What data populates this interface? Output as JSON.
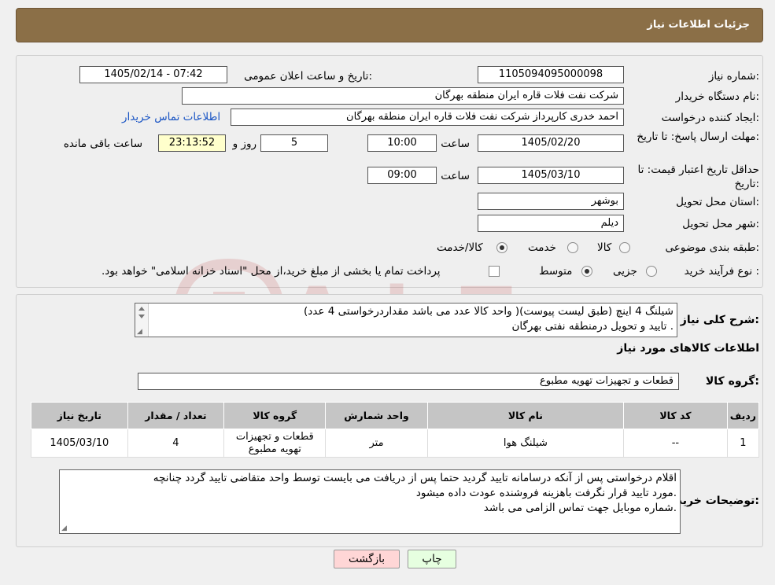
{
  "header": {
    "title": "جزئیات اطلاعات نیاز"
  },
  "form": {
    "need_number_label": "شماره نیاز:",
    "need_number": "1105094095000098",
    "announce_label": "تاریخ و ساعت اعلان عمومی:",
    "announce_value": "1405/02/14 - 07:42",
    "buyer_org_label": "نام دستگاه خریدار:",
    "buyer_org": "شرکت نفت فلات قاره ایران منطقه بهرگان",
    "creator_label": "ایجاد کننده درخواست:",
    "creator": "احمد خدری کارپرداز شرکت نفت فلات قاره ایران منطقه بهرگان",
    "contact_link": "اطلاعات تماس خریدار",
    "deadline_label": "مهلت ارسال پاسخ: تا تاریخ:",
    "deadline_date": "1405/02/20",
    "time_label": "ساعت",
    "deadline_time": "10:00",
    "days_value": "5",
    "days_label": "روز و",
    "remaining_time": "23:13:52",
    "remaining_label": "ساعت باقی مانده",
    "validity_label": "حداقل تاریخ اعتبار قیمت: تا تاریخ:",
    "validity_date": "1405/03/10",
    "validity_time": "09:00",
    "province_label": "استان محل تحویل:",
    "province": "بوشهر",
    "city_label": "شهر محل تحویل:",
    "city": "دیلم",
    "category_label": "طبقه بندی موضوعی:",
    "category_options": [
      "کالا",
      "خدمت",
      "کالا/خدمت"
    ],
    "purchase_label": "نوع فرآیند خرید :",
    "purchase_options": [
      "جزیی",
      "متوسط"
    ],
    "purchase_note": "پرداخت تمام یا بخشی از مبلغ خرید،از محل \"اسناد خزانه اسلامی\" خواهد بود."
  },
  "details": {
    "description_label": "شرح کلی نیاز:",
    "description_lines": [
      "شیلنگ 4 اینچ (طبق لیست پیوست)( واحد کالا عدد می باشد مقداردرخواستی 4 عدد)",
      "تایید و تحویل درمنطقه نفتی بهرگان ."
    ],
    "goods_info_title": "اطلاعات کالاهای مورد نیاز",
    "goods_group_label": "گروه کالا:",
    "goods_group": "قطعات و تجهیزات تهویه مطبوع",
    "table": {
      "headers": [
        "ردیف",
        "کد کالا",
        "نام کالا",
        "واحد شمارش",
        "گروه کالا",
        "تعداد / مقدار",
        "تاریخ نیاز"
      ],
      "rows": [
        [
          "1",
          "--",
          "شیلنگ هوا",
          "متر",
          "قطعات و تجهیزات تهویه مطبوع",
          "4",
          "1405/03/10"
        ]
      ]
    },
    "buyer_notes_label": "توضیحات خریدار:",
    "buyer_notes_lines": [
      "اقلام درخواستی پس از آنکه درسامانه تایید گردید حتما پس از دریافت می بایست توسط واحد متقاضی تایید گردد چنانچه",
      "مورد تایید قرار نگرفت باهزینه فروشنده عودت داده میشود.",
      "شماره موبایل جهت تماس الزامی می باشد."
    ]
  },
  "buttons": {
    "print": "چاپ",
    "back": "بازگشت"
  },
  "colors": {
    "header_bg": "#8b6f47",
    "link": "#1a55c4",
    "back_btn": "#ffd6d6",
    "print_btn": "#e6ffe0"
  }
}
